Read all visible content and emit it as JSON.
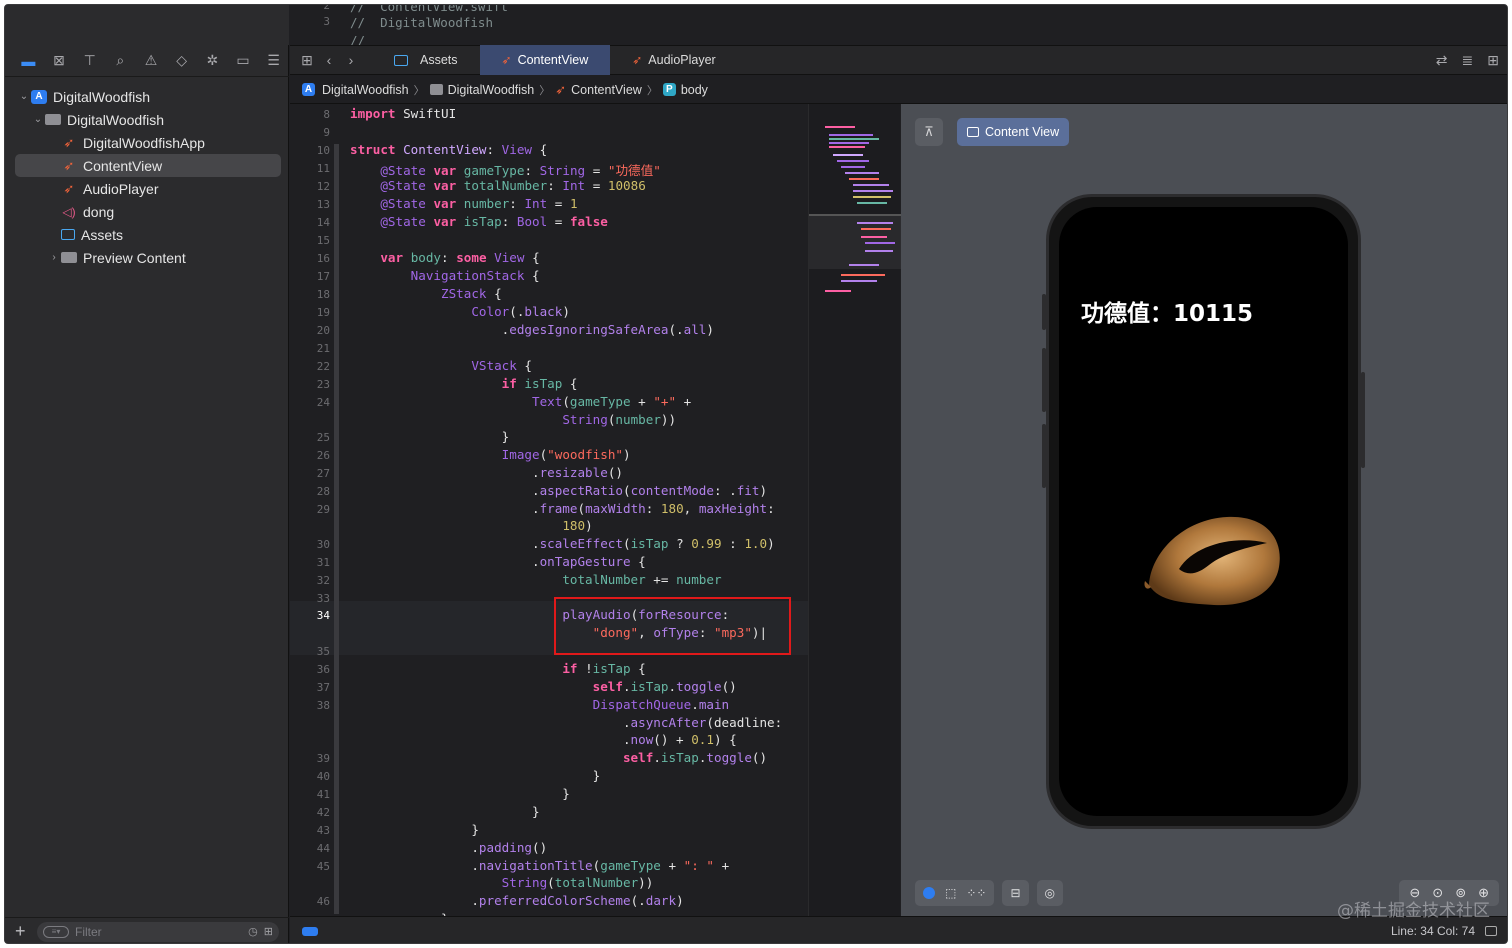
{
  "top_code": {
    "line2": "//  ContentView.swift",
    "line3": "//  DigitalWoodfish",
    "line3_num": "3",
    "line2_num": "2",
    "line4": "//"
  },
  "navigator": {
    "tabs": [
      "folder-icon",
      "source-control-icon",
      "symbol-icon",
      "search-icon",
      "warning-icon",
      "test-icon",
      "debug-icon",
      "breakpoint-icon",
      "report-icon"
    ],
    "tree": [
      {
        "label": "DigitalWoodfish",
        "level": 0,
        "icon": "project",
        "expanded": true
      },
      {
        "label": "DigitalWoodfish",
        "level": 1,
        "icon": "folder",
        "expanded": true
      },
      {
        "label": "DigitalWoodfishApp",
        "level": 2,
        "icon": "swift"
      },
      {
        "label": "ContentView",
        "level": 2,
        "icon": "swift",
        "selected": true
      },
      {
        "label": "AudioPlayer",
        "level": 2,
        "icon": "swift"
      },
      {
        "label": "dong",
        "level": 2,
        "icon": "audio"
      },
      {
        "label": "Assets",
        "level": 2,
        "icon": "assets"
      },
      {
        "label": "Preview Content",
        "level": 1,
        "icon": "folder",
        "expanded": false
      }
    ],
    "filter_placeholder": "Filter"
  },
  "tabs": [
    {
      "label": "Assets",
      "icon": "assets"
    },
    {
      "label": "ContentView",
      "icon": "swift",
      "active": true
    },
    {
      "label": "AudioPlayer",
      "icon": "swift"
    }
  ],
  "breadcrumb": {
    "items": [
      "DigitalWoodfish",
      "DigitalWoodfish",
      "ContentView",
      "body"
    ],
    "badge": "P"
  },
  "preview": {
    "pin_icon": "pin-icon",
    "content_view_label": "Content View",
    "phone_text": "功德值：10115"
  },
  "status": {
    "line_col": "Line: 34  Col: 74"
  },
  "watermark": "@稀土掘金技术社区",
  "colors": {
    "keyword": "#fc5fa3",
    "string": "#fc6a5d",
    "number": "#d0bf69",
    "accent": "#2e7df0",
    "highlight_box": "#e0191a"
  }
}
